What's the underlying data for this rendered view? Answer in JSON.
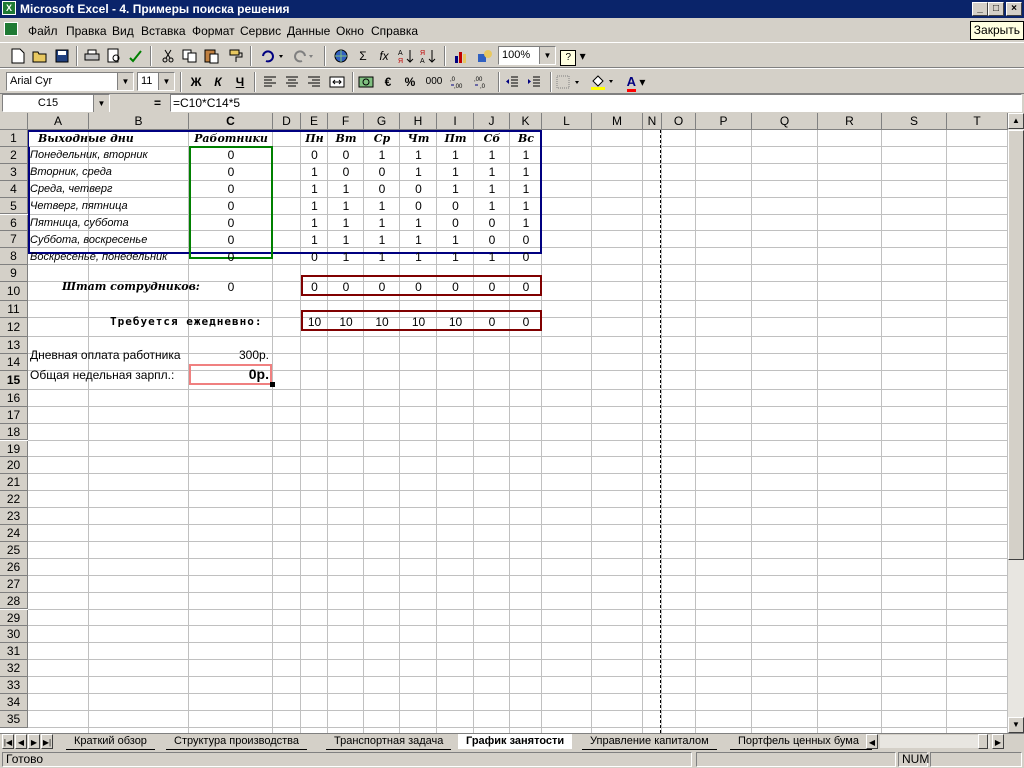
{
  "window": {
    "title": "Microsoft Excel - 4. Примеры поиска решения",
    "app_icon": "X",
    "controls": {
      "minimize": "_",
      "maximize": "□",
      "close": "×"
    },
    "close_tooltip": "Закрыть"
  },
  "menu": [
    "Файл",
    "Правка",
    "Вид",
    "Вставка",
    "Формат",
    "Сервис",
    "Данные",
    "Окно",
    "Справка"
  ],
  "standard_toolbar": {
    "zoom": "100%",
    "sigma": "Σ",
    "fx": "fx",
    "help": "?"
  },
  "format_toolbar": {
    "font_name": "Arial Cyr",
    "font_size": "11",
    "bold": "Ж",
    "italic": "К",
    "underline": "Ч",
    "euro": "€",
    "percent": "%",
    "thousands": "000",
    "font_color_letter": "A"
  },
  "formula_bar": {
    "name_box": "C15",
    "equals": "=",
    "formula": "=C10*C14*5"
  },
  "columns": [
    "A",
    "B",
    "C",
    "D",
    "E",
    "F",
    "G",
    "H",
    "I",
    "J",
    "K",
    "L",
    "M",
    "N",
    "O",
    "P",
    "Q",
    "R",
    "S",
    "T"
  ],
  "rows": [
    "1",
    "2",
    "3",
    "4",
    "5",
    "6",
    "7",
    "8",
    "9",
    "10",
    "11",
    "12",
    "13",
    "14",
    "15",
    "16",
    "17",
    "18",
    "19",
    "20",
    "21",
    "22",
    "23",
    "24",
    "25",
    "26",
    "27",
    "28",
    "29",
    "30",
    "31",
    "32",
    "33",
    "34",
    "35"
  ],
  "table": {
    "header_days_off": "Выходные дни",
    "header_workers": "Работники",
    "day_headers": [
      "Пн",
      "Вт",
      "Ср",
      "Чт",
      "Пт",
      "Сб",
      "Вс"
    ],
    "rows": [
      {
        "label": "Понедельник, вторник",
        "workers": "0",
        "days": [
          "0",
          "0",
          "1",
          "1",
          "1",
          "1",
          "1"
        ]
      },
      {
        "label": "Вторник, среда",
        "workers": "0",
        "days": [
          "1",
          "0",
          "0",
          "1",
          "1",
          "1",
          "1"
        ]
      },
      {
        "label": "Среда, четверг",
        "workers": "0",
        "days": [
          "1",
          "1",
          "0",
          "0",
          "1",
          "1",
          "1"
        ]
      },
      {
        "label": "Четверг, пятница",
        "workers": "0",
        "days": [
          "1",
          "1",
          "1",
          "0",
          "0",
          "1",
          "1"
        ]
      },
      {
        "label": "Пятница, суббота",
        "workers": "0",
        "days": [
          "1",
          "1",
          "1",
          "1",
          "0",
          "0",
          "1"
        ]
      },
      {
        "label": "Суббота, воскресенье",
        "workers": "0",
        "days": [
          "1",
          "1",
          "1",
          "1",
          "1",
          "0",
          "0"
        ]
      },
      {
        "label": "Воскресенье, понедельник",
        "workers": "0",
        "days": [
          "0",
          "1",
          "1",
          "1",
          "1",
          "1",
          "0"
        ]
      }
    ],
    "staff_label": "Штат сотрудников:",
    "staff_value": "0",
    "staff_days": [
      "0",
      "0",
      "0",
      "0",
      "0",
      "0",
      "0"
    ],
    "required_label": "Требуется  ежедневно:",
    "required_days": [
      "10",
      "10",
      "10",
      "10",
      "10",
      "0",
      "0"
    ],
    "daily_pay_label": "Дневная оплата работника",
    "daily_pay_value": "300р.",
    "weekly_total_label": "Общая недельная зарпл.:",
    "weekly_total_value": "0р."
  },
  "sheet_tabs": [
    "Краткий обзор",
    "Структура производства",
    "Транспортная задача",
    "График занятости",
    "Управление капиталом",
    "Портфель ценных бума"
  ],
  "active_tab": "График занятости",
  "status": {
    "ready": "Готово",
    "num": "NUM"
  },
  "colors": {
    "title_bar": "#0a246a",
    "green_border": "#008000",
    "navy_border": "#000080",
    "maroon_border": "#800000",
    "active_cell_border": "#f08080"
  }
}
